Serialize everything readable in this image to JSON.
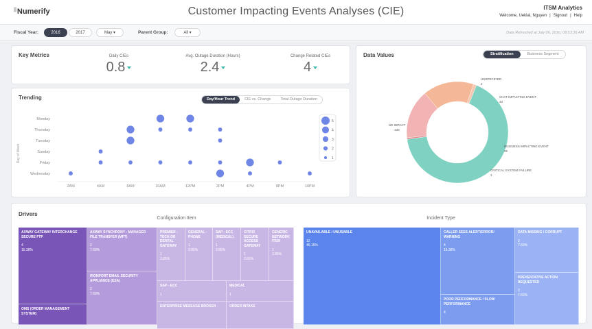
{
  "header": {
    "logo": "Numerify",
    "logo_mark": "||",
    "title": "Customer Impacting Events Analyses (CIE)",
    "product": "ITSM Analytics",
    "welcome": "Welcome, Uekial, Nguyen",
    "signout": "Signout",
    "help": "Help",
    "sep": "|"
  },
  "filters": {
    "fiscal_label": "Fiscal Year:",
    "years": [
      "2016",
      "2017"
    ],
    "selected_year": "2016",
    "month": "May",
    "group_label": "Parent Group:",
    "group": "All",
    "refreshed": "Data Refreshed at July 06, 2016, 08:53:36 AM"
  },
  "metrics": {
    "title": "Key Metrics",
    "items": [
      {
        "label": "Daily CIEs",
        "value": "0.8"
      },
      {
        "label": "Avg. Outage Duration (Hours)",
        "value": "2.4"
      },
      {
        "label": "Change Related CIEs",
        "value": "4"
      }
    ]
  },
  "trending": {
    "title": "Trending",
    "tabs": [
      "Day/Hour Trend",
      "CIE vs. Change",
      "Total Outage Duration"
    ],
    "active_tab": "Day/Hour Trend",
    "y_axis_label": "Day of Week",
    "days": [
      "Monday",
      "Thursday",
      "Tuesday",
      "Sunday",
      "Friday",
      "Wednesday"
    ],
    "hours": [
      "2AM",
      "4AM",
      "8AM",
      "10AM",
      "12PM",
      "2PM",
      "4PM",
      "8PM",
      "10PM"
    ],
    "legend": [
      "5",
      "4",
      "3",
      "2",
      "1"
    ],
    "accent": "#6f86e6"
  },
  "chart_data": {
    "type": "scatter",
    "y_categories": [
      "Monday",
      "Thursday",
      "Tuesday",
      "Sunday",
      "Friday",
      "Wednesday"
    ],
    "x_categories": [
      "2AM",
      "4AM",
      "8AM",
      "10AM",
      "12PM",
      "2PM",
      "4PM",
      "8PM",
      "10PM"
    ],
    "points": [
      {
        "x": "10AM",
        "y": "Monday",
        "size": 3
      },
      {
        "x": "12PM",
        "y": "Monday",
        "size": 3
      },
      {
        "x": "8AM",
        "y": "Thursday",
        "size": 3
      },
      {
        "x": "10AM",
        "y": "Thursday",
        "size": 1
      },
      {
        "x": "12PM",
        "y": "Thursday",
        "size": 1
      },
      {
        "x": "2PM",
        "y": "Thursday",
        "size": 1
      },
      {
        "x": "8AM",
        "y": "Tuesday",
        "size": 3
      },
      {
        "x": "2PM",
        "y": "Tuesday",
        "size": 1
      },
      {
        "x": "4AM",
        "y": "Sunday",
        "size": 1
      },
      {
        "x": "4AM",
        "y": "Friday",
        "size": 1
      },
      {
        "x": "8AM",
        "y": "Friday",
        "size": 1
      },
      {
        "x": "10AM",
        "y": "Friday",
        "size": 1
      },
      {
        "x": "12PM",
        "y": "Friday",
        "size": 1
      },
      {
        "x": "2PM",
        "y": "Friday",
        "size": 1
      },
      {
        "x": "4PM",
        "y": "Friday",
        "size": 3
      },
      {
        "x": "8PM",
        "y": "Friday",
        "size": 1
      },
      {
        "x": "2AM",
        "y": "Wednesday",
        "size": 1
      },
      {
        "x": "2PM",
        "y": "Wednesday",
        "size": 3
      },
      {
        "x": "4PM",
        "y": "Wednesday",
        "size": 1
      },
      {
        "x": "10PM",
        "y": "Wednesday",
        "size": 1
      }
    ],
    "legend_sizes": [
      5,
      4,
      3,
      2,
      1
    ]
  },
  "data_values": {
    "title": "Data Values",
    "tabs": [
      "Stratification",
      "Business Segment"
    ],
    "active_tab": "Stratification",
    "slices": [
      {
        "name": "NO IMPACT",
        "value": 136,
        "color": "#7fd1c1"
      },
      {
        "name": "UNSPECIFIED",
        "value": 2,
        "color": "#f5c7b0"
      },
      {
        "name": "CHAT IMPACTING EVENT",
        "value": 33,
        "color": "#f4b797"
      },
      {
        "name": "BUSINESS IMPACTING EVENT",
        "value": 32,
        "color": "#f1b3b4"
      },
      {
        "name": "CRITICAL SYSTEM FAILURE",
        "value": 1,
        "color": "#d9878a"
      }
    ]
  },
  "drivers": {
    "title": "Drivers",
    "config_title": "Configuration Item",
    "incident_title": "Incident Type",
    "config_items": [
      {
        "label": "AXWAY GATEWAY INTERCHANGE SECURE FTP",
        "count": "4",
        "pct": "15.38%",
        "color": "#7a55b8"
      },
      {
        "label": "OMS (ORDER MANAGEMENT SYSTEM)",
        "count": "",
        "pct": "",
        "color": "#7a55b8"
      },
      {
        "label": "AXWAY SYNCHRONY - MANAGED FILE TRANSFER (MFT)",
        "count": "2",
        "pct": "7.69%",
        "color": "#b49bdb"
      },
      {
        "label": "IRONPORT EMAIL SECURITY APPLIANCE (ESA)",
        "count": "2",
        "pct": "7.69%",
        "color": "#b49bdb"
      },
      {
        "label": "PREMIER - TECH OR DENTAL GATEWAY",
        "count": "1",
        "pct": "3.85%",
        "color": "#c8b6e5"
      },
      {
        "label": "GENERAL - PHONE",
        "count": "1",
        "pct": "3.85%",
        "color": "#c8b6e5"
      },
      {
        "label": "SAP - ECC (MEDICAL)",
        "count": "1",
        "pct": "3.85%",
        "color": "#c8b6e5"
      },
      {
        "label": "CITRIX SECURE ACCESS GATEWAY",
        "count": "1",
        "pct": "3.85%",
        "color": "#c8b6e5"
      },
      {
        "label": "GENERIC NETWORK ITEM",
        "count": "1",
        "pct": "3.85%",
        "color": "#c8b6e5"
      },
      {
        "label": "SAP - ECC",
        "count": "1",
        "pct": "",
        "color": "#c8b6e5"
      },
      {
        "label": "MEDICAL",
        "count": "1",
        "pct": "",
        "color": "#c8b6e5"
      },
      {
        "label": "ENTERPRISE MESSAGE BROKER",
        "count": "",
        "pct": "",
        "color": "#c8b6e5"
      },
      {
        "label": "ORDER INTAKE",
        "count": "",
        "pct": "",
        "color": "#c8b6e5"
      }
    ],
    "incident_items": [
      {
        "label": "UNAVAILABLE / UNUSABLE",
        "count": "12",
        "pct": "46.15%",
        "color": "#5b84ec"
      },
      {
        "label": "CALLER SEES ALERT/ERROR/ WARNING",
        "count": "4",
        "pct": "15.38%",
        "color": "#7c9cf0"
      },
      {
        "label": "POOR PERFORMANCE / SLOW PERFORMANCE",
        "count": "4",
        "pct": "",
        "color": "#7c9cf0"
      },
      {
        "label": "DATA MISSING / CORRUPT",
        "count": "2",
        "pct": "7.69%",
        "color": "#9bb3f4"
      },
      {
        "label": "PREVENTATIVE ACTION REQUESTED",
        "count": "2",
        "pct": "7.69%",
        "color": "#9bb3f4"
      }
    ]
  }
}
